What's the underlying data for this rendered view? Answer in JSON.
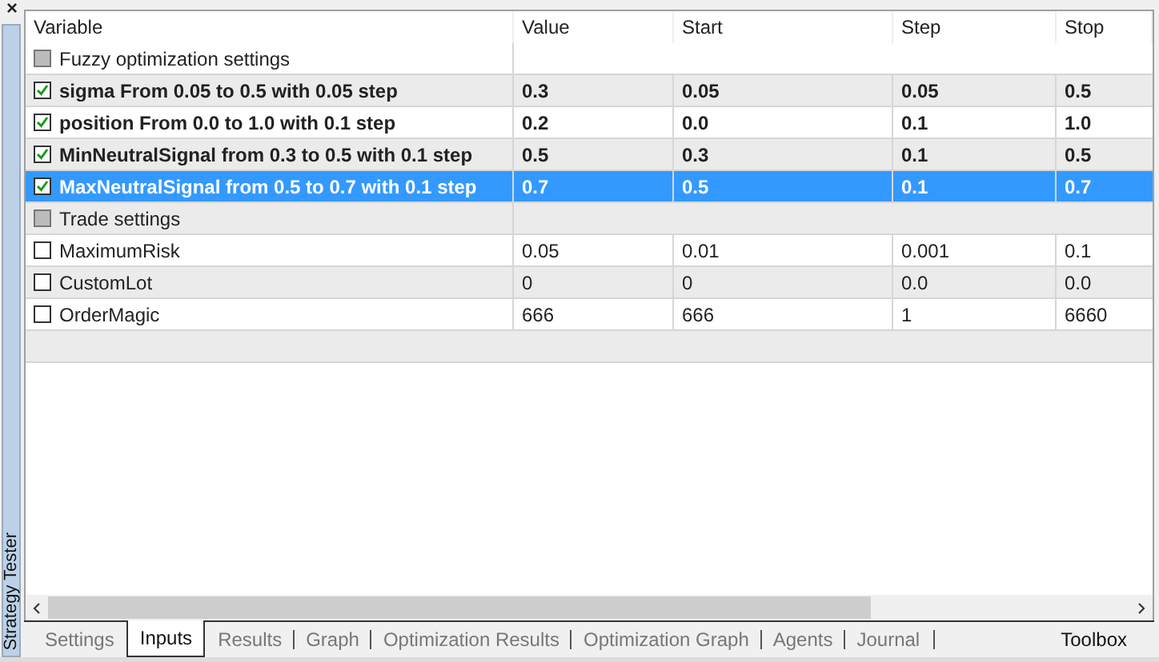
{
  "panel": {
    "title": "Strategy Tester",
    "close": "×"
  },
  "table": {
    "columns": [
      "Variable",
      "Value",
      "Start",
      "Step",
      "Stop"
    ],
    "rows": [
      {
        "kind": "group",
        "name": "Fuzzy optimization settings",
        "checked": false,
        "selected": false
      },
      {
        "kind": "param",
        "name": "sigma From 0.05 to 0.5 with 0.05 step",
        "checked": true,
        "selected": false,
        "value": "0.3",
        "start": "0.05",
        "step": "0.05",
        "stop": "0.5"
      },
      {
        "kind": "param",
        "name": "position From 0.0 to 1.0 with 0.1 step",
        "checked": true,
        "selected": false,
        "value": "0.2",
        "start": "0.0",
        "step": "0.1",
        "stop": "1.0"
      },
      {
        "kind": "param",
        "name": "MinNeutralSignal from 0.3 to 0.5 with 0.1 step",
        "checked": true,
        "selected": false,
        "value": "0.5",
        "start": "0.3",
        "step": "0.1",
        "stop": "0.5"
      },
      {
        "kind": "param",
        "name": "MaxNeutralSignal from 0.5 to 0.7 with 0.1 step",
        "checked": true,
        "selected": true,
        "value": "0.7",
        "start": "0.5",
        "step": "0.1",
        "stop": "0.7"
      },
      {
        "kind": "group",
        "name": "Trade settings",
        "checked": false,
        "selected": false
      },
      {
        "kind": "param",
        "name": "MaximumRisk",
        "checked": false,
        "selected": false,
        "value": "0.05",
        "start": "0.01",
        "step": "0.001",
        "stop": "0.1"
      },
      {
        "kind": "param",
        "name": "CustomLot",
        "checked": false,
        "selected": false,
        "value": "0",
        "start": "0",
        "step": "0.0",
        "stop": "0.0"
      },
      {
        "kind": "param",
        "name": "OrderMagic",
        "checked": false,
        "selected": false,
        "value": "666",
        "start": "666",
        "step": "1",
        "stop": "6660"
      }
    ]
  },
  "tabs": [
    {
      "label": "Settings",
      "selected": false
    },
    {
      "label": "Inputs",
      "selected": true
    },
    {
      "label": "Results",
      "selected": false
    },
    {
      "label": "Graph",
      "selected": false
    },
    {
      "label": "Optimization Results",
      "selected": false
    },
    {
      "label": "Optimization Graph",
      "selected": false
    },
    {
      "label": "Agents",
      "selected": false
    },
    {
      "label": "Journal",
      "selected": false
    }
  ],
  "toolbox": "Toolbox"
}
